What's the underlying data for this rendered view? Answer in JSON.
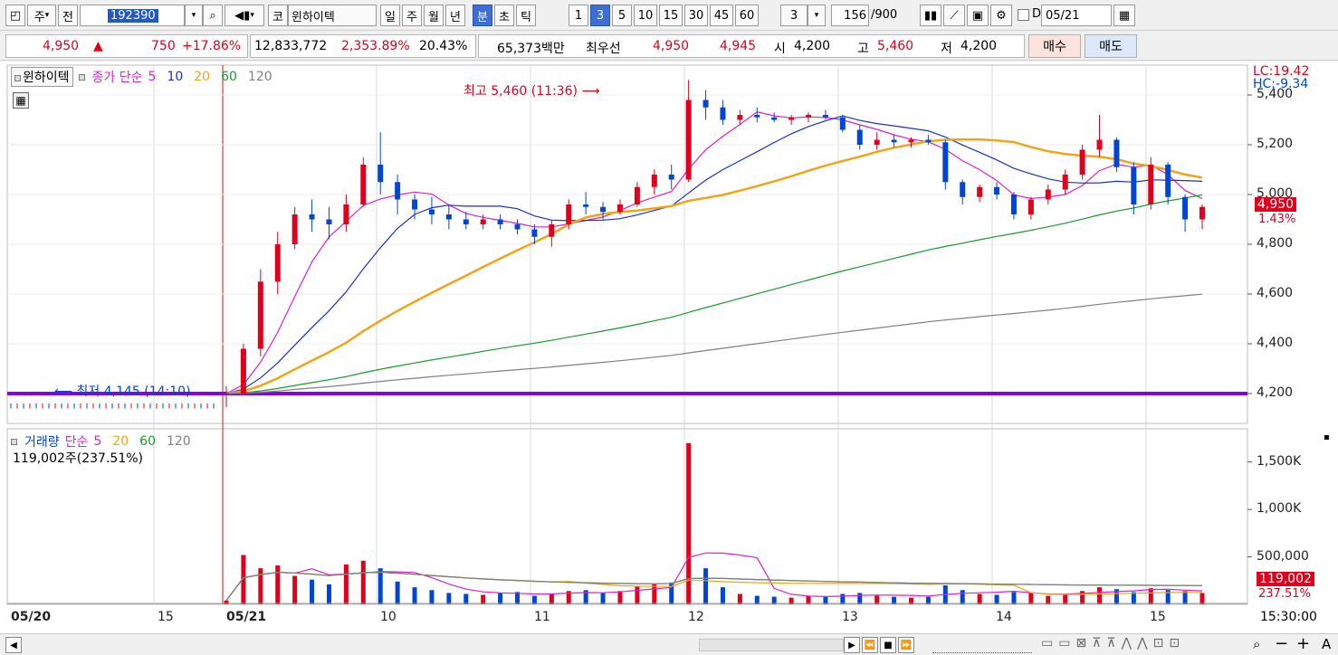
{
  "toolbar": {
    "market": "주",
    "prev": "전",
    "code": "192390",
    "exchange_badge": "코",
    "stock_name": "윈하이텍",
    "periods": [
      "일",
      "주",
      "월",
      "년",
      "분",
      "초",
      "틱"
    ],
    "selected_period": "분",
    "intervals": [
      "1",
      "3",
      "5",
      "10",
      "15",
      "30",
      "45",
      "60"
    ],
    "selected_interval": "3",
    "interval_select": "3",
    "count": "156",
    "count_total": "/900",
    "date_check": "D",
    "date": "05/21"
  },
  "quote": {
    "price": "4,950",
    "change_arrow": "▲",
    "change": "750",
    "change_pct": "+17.86%",
    "volume": "12,833,772",
    "volume_pct": "2,353.89%",
    "turnover": "20.43%",
    "amount": "65,373백만",
    "best_label": "최우선",
    "best_ask": "4,950",
    "best_bid": "4,945",
    "open_label": "시",
    "open": "4,200",
    "high_label": "고",
    "high": "5,460",
    "low_label": "저",
    "low": "4,200",
    "buy": "매수",
    "sell": "매도"
  },
  "price_panel": {
    "legend_name": "윈하이텍",
    "legend_type": "종가 단순",
    "ma": [
      {
        "period": "5",
        "color": "#e01fd0"
      },
      {
        "period": "10",
        "color": "#1a2fcf"
      },
      {
        "period": "20",
        "color": "#f2a418"
      },
      {
        "period": "60",
        "color": "#1a9a2b"
      },
      {
        "period": "120",
        "color": "#808080"
      }
    ],
    "high_note": "최고 5,460 (11:36)",
    "low_note": "최저 4,145 (14:10)",
    "lc": "LC:19.42",
    "hc": "HC:-9.34",
    "y_ticks": [
      "5,400",
      "5,200",
      "5,000",
      "4,800",
      "4,600",
      "4,400",
      "4,200"
    ],
    "last_price": "4,950",
    "last_pct": "1.43%",
    "ref_line_color": "#8a00e6"
  },
  "volume_panel": {
    "legend_name": "거래량",
    "legend_type": "단순",
    "ma": [
      {
        "period": "5",
        "color": "#e01fd0"
      },
      {
        "period": "20",
        "color": "#f2a418"
      },
      {
        "period": "60",
        "color": "#1a9a2b"
      },
      {
        "period": "120",
        "color": "#808080"
      }
    ],
    "info": "119,002주(237.51%)",
    "y_ticks": [
      "1,500K",
      "1,000K",
      "500,000"
    ],
    "last_volume": "119,002",
    "last_pct": "237.51%"
  },
  "time_axis": [
    "05/20",
    "15",
    "05/21",
    "10",
    "11",
    "12",
    "13",
    "14",
    "15"
  ],
  "time_bold": [
    "05/20",
    "05/21"
  ],
  "time_right": "15:30:00",
  "colors": {
    "up": "#e0001b",
    "down": "#0046d5"
  },
  "chart_data": {
    "type": "candlestick",
    "title": "윈하이텍 (192390) 3분봉",
    "ylim": [
      4080,
      5520
    ],
    "volume_ylim": [
      0,
      1850000
    ],
    "series": [
      {
        "name": "candles",
        "values": [
          [
            4200,
            4230,
            4145,
            4200
          ],
          [
            4200,
            4400,
            4200,
            4380
          ],
          [
            4380,
            4700,
            4350,
            4650
          ],
          [
            4650,
            4850,
            4600,
            4800
          ],
          [
            4800,
            4950,
            4780,
            4920
          ],
          [
            4920,
            4980,
            4850,
            4900
          ],
          [
            4900,
            4950,
            4820,
            4880
          ],
          [
            4880,
            5000,
            4850,
            4960
          ],
          [
            4960,
            5150,
            4950,
            5120
          ],
          [
            5120,
            5250,
            5000,
            5050
          ],
          [
            5050,
            5080,
            4920,
            4980
          ],
          [
            4980,
            5000,
            4900,
            4940
          ],
          [
            4940,
            4990,
            4880,
            4920
          ],
          [
            4920,
            4960,
            4860,
            4900
          ],
          [
            4900,
            4930,
            4860,
            4880
          ],
          [
            4880,
            4920,
            4860,
            4900
          ],
          [
            4900,
            4920,
            4860,
            4880
          ],
          [
            4880,
            4900,
            4840,
            4860
          ],
          [
            4860,
            4880,
            4800,
            4830
          ],
          [
            4830,
            4900,
            4790,
            4880
          ],
          [
            4880,
            4980,
            4860,
            4960
          ],
          [
            4960,
            5010,
            4920,
            4950
          ],
          [
            4950,
            4970,
            4900,
            4930
          ],
          [
            4930,
            4980,
            4920,
            4960
          ],
          [
            4960,
            5050,
            4950,
            5030
          ],
          [
            5030,
            5100,
            5000,
            5080
          ],
          [
            5080,
            5120,
            5020,
            5060
          ],
          [
            5060,
            5460,
            5050,
            5380
          ],
          [
            5380,
            5420,
            5300,
            5350
          ],
          [
            5350,
            5380,
            5280,
            5300
          ],
          [
            5300,
            5340,
            5280,
            5320
          ],
          [
            5320,
            5350,
            5290,
            5310
          ],
          [
            5310,
            5330,
            5290,
            5300
          ],
          [
            5300,
            5320,
            5280,
            5310
          ],
          [
            5310,
            5330,
            5290,
            5320
          ],
          [
            5320,
            5340,
            5300,
            5310
          ],
          [
            5310,
            5320,
            5250,
            5260
          ],
          [
            5260,
            5280,
            5180,
            5200
          ],
          [
            5200,
            5250,
            5180,
            5220
          ],
          [
            5220,
            5240,
            5190,
            5210
          ],
          [
            5210,
            5230,
            5190,
            5220
          ],
          [
            5220,
            5240,
            5200,
            5210
          ],
          [
            5210,
            5220,
            5020,
            5050
          ],
          [
            5050,
            5060,
            4960,
            4990
          ],
          [
            4990,
            5040,
            4970,
            5030
          ],
          [
            5030,
            5050,
            4980,
            5000
          ],
          [
            5000,
            5010,
            4900,
            4920
          ],
          [
            4920,
            4990,
            4900,
            4980
          ],
          [
            4980,
            5040,
            4960,
            5020
          ],
          [
            5020,
            5100,
            5000,
            5080
          ],
          [
            5080,
            5200,
            5060,
            5180
          ],
          [
            5180,
            5320,
            5150,
            5220
          ],
          [
            5220,
            5230,
            5090,
            5110
          ],
          [
            5110,
            5130,
            4920,
            4960
          ],
          [
            4960,
            5150,
            4940,
            5120
          ],
          [
            5120,
            5130,
            4960,
            4990
          ],
          [
            4990,
            5000,
            4850,
            4900
          ],
          [
            4900,
            4960,
            4860,
            4950
          ]
        ]
      },
      {
        "name": "volume",
        "values": [
          40000,
          520000,
          380000,
          410000,
          300000,
          260000,
          210000,
          420000,
          460000,
          380000,
          240000,
          180000,
          150000,
          120000,
          110000,
          100000,
          120000,
          130000,
          90000,
          110000,
          140000,
          150000,
          120000,
          140000,
          190000,
          210000,
          230000,
          1700000,
          380000,
          180000,
          110000,
          90000,
          80000,
          70000,
          90000,
          80000,
          110000,
          120000,
          90000,
          80000,
          70000,
          80000,
          200000,
          150000,
          110000,
          100000,
          130000,
          120000,
          90000,
          100000,
          140000,
          180000,
          160000,
          130000,
          170000,
          150000,
          140000,
          119002
        ]
      }
    ]
  }
}
